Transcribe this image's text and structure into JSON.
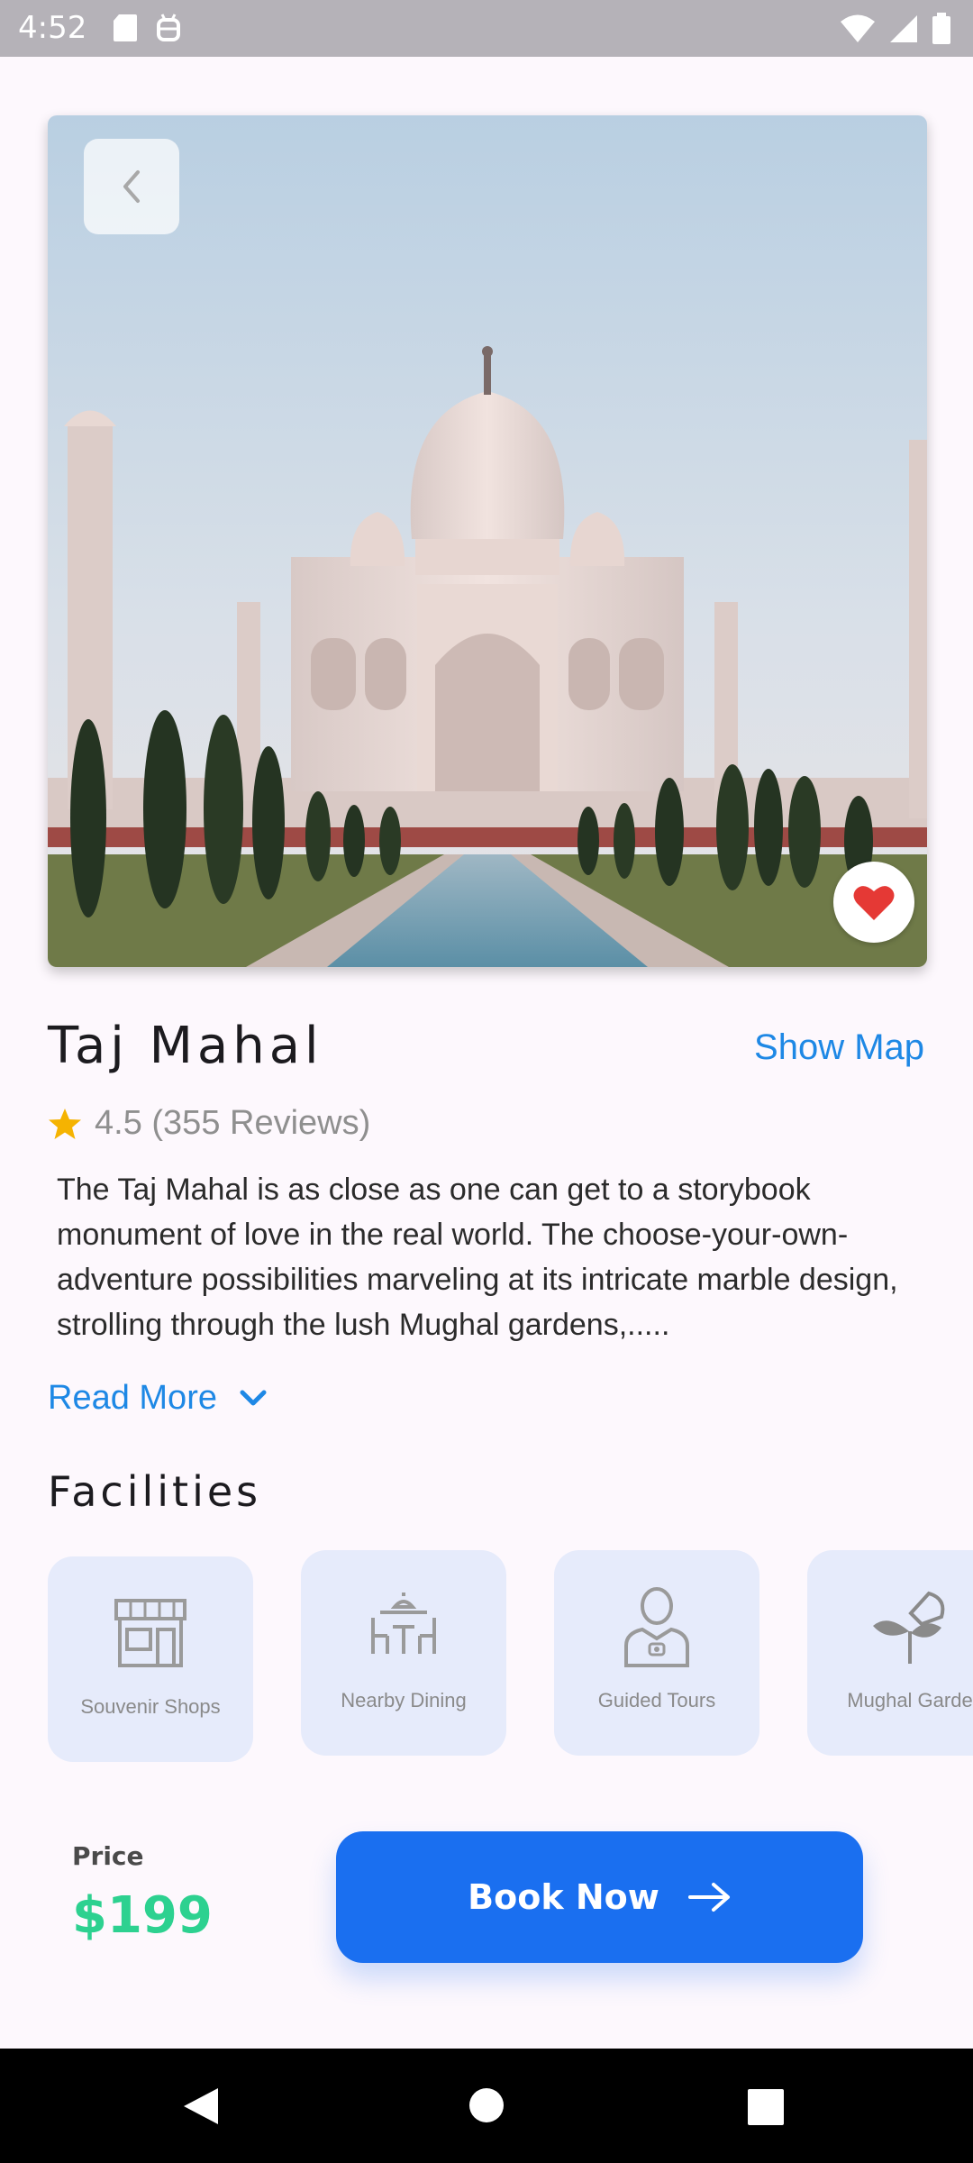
{
  "status_bar": {
    "time": "4:52"
  },
  "place": {
    "name": "Taj Mahal",
    "show_map_label": "Show Map",
    "rating": "4.5",
    "reviews": "(355 Reviews)",
    "description": "The Taj Mahal is as close as one can get to a storybook monument of love in the real world. The choose-your-own-adventure possibilities marveling at its intricate marble design, strolling through the lush Mughal gardens,.....",
    "read_more_label": "Read More"
  },
  "facilities": {
    "title": "Facilities",
    "items": [
      {
        "label": "Souvenir Shops",
        "icon": "shop-icon"
      },
      {
        "label": "Nearby Dining",
        "icon": "dining-icon"
      },
      {
        "label": "Guided Tours",
        "icon": "guide-icon"
      },
      {
        "label": "Mughal Garde",
        "icon": "plant-icon"
      }
    ]
  },
  "booking": {
    "price_label": "Price",
    "price_value": "$199",
    "book_label": "Book Now"
  },
  "colors": {
    "accent_blue": "#1e88e5",
    "button_blue": "#1a6ff0",
    "price_green": "#2dd190",
    "heart_red": "#e53935",
    "star_yellow": "#f5b301"
  }
}
